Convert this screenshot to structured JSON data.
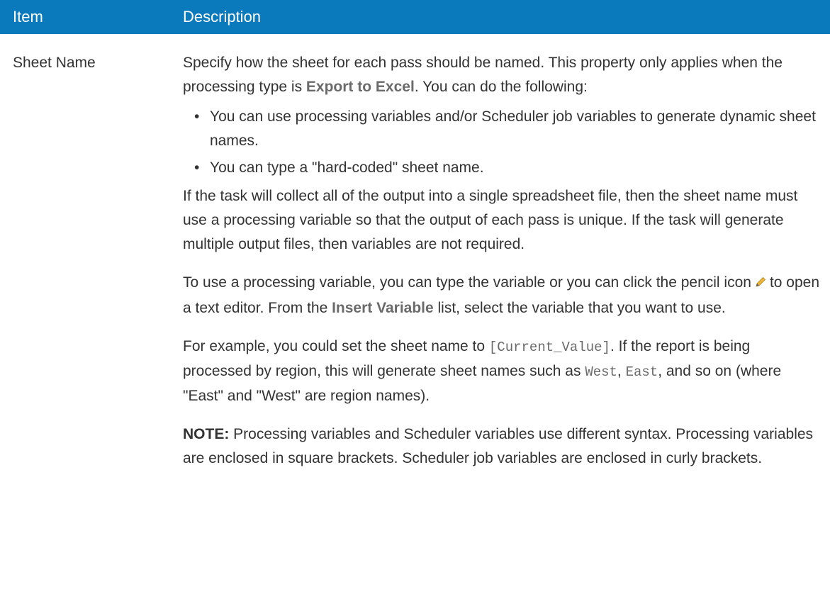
{
  "header": {
    "item_label": "Item",
    "description_label": "Description"
  },
  "row": {
    "item": "Sheet Name",
    "intro": {
      "before": "Specify how the sheet for each pass should be named. This property only applies when the processing type is ",
      "term": "Export to Excel",
      "after": ". You can do the following:"
    },
    "bullets": [
      "You can use processing variables and/or Scheduler job variables to generate dynamic sheet names.",
      "You can type a \"hard-coded\" sheet name."
    ],
    "para_collect": "If the task will collect all of the output into a single spreadsheet file, then the sheet name must use a processing variable so that the output of each pass is unique. If the task will generate multiple output files, then variables are not required.",
    "para_use": {
      "before_icon": "To use a processing variable, you can type the variable or you can click the pencil icon",
      "after_icon": "to open a text editor. From the ",
      "term": "Insert Variable",
      "after": " list, select the variable that you want to use."
    },
    "para_example": {
      "before": "For example, you could set the sheet name to ",
      "code1": "[Current_Value]",
      "middle": ". If the report is being processed by region, this will generate sheet names such as ",
      "code2": "West",
      "comma": ", ",
      "code3": "East",
      "after": ", and so on (where \"East\" and \"West\" are region names)."
    },
    "note": {
      "label": "NOTE:",
      "text": " Processing variables and Scheduler variables use different syntax. Processing variables are enclosed in square brackets. Scheduler job variables are enclosed in curly brackets."
    }
  },
  "colors": {
    "header_bg": "#0a7abd",
    "header_text": "#ffffff",
    "body_text": "#333333",
    "ui_term": "#6a6a6a",
    "pencil": "#e8b53a"
  }
}
